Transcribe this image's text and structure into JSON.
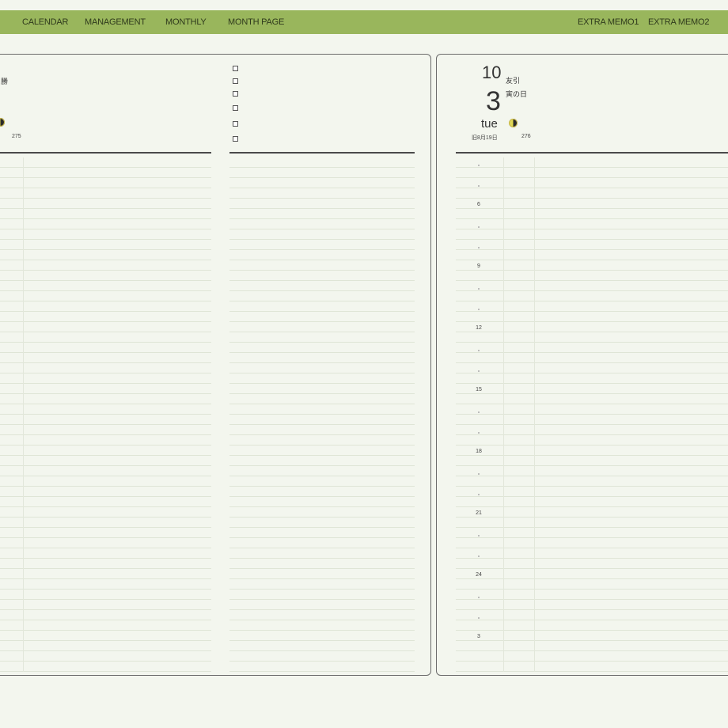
{
  "nav": {
    "calendar": "CALENDAR",
    "management": "MANAGEMENT",
    "monthly": "MONTHLY",
    "month_page": "MONTH PAGE",
    "extra_memo1": "EXTRA MEMO1",
    "extra_memo2": "EXTRA MEMO2"
  },
  "left_page": {
    "rokuyo_partial": "勝",
    "day_of_year": "275",
    "checkbox_count": 6
  },
  "right_page": {
    "month": "10",
    "day": "3",
    "weekday": "tue",
    "rokuyo": "友引",
    "event": "寅の日",
    "lunar_date": "旧8月19日",
    "day_of_year": "276",
    "hour_labels": [
      "6",
      "9",
      "12",
      "15",
      "18",
      "21",
      "24",
      "3"
    ]
  },
  "colors": {
    "nav_bar": "#99b65c",
    "page_background": "#f3f6ee",
    "moon_light": "#e6dc4a",
    "moon_dark": "#2b2b2b"
  },
  "icons": {
    "moon_phase": "half-moon-icon",
    "todo_checkbox": "checkbox-icon"
  }
}
